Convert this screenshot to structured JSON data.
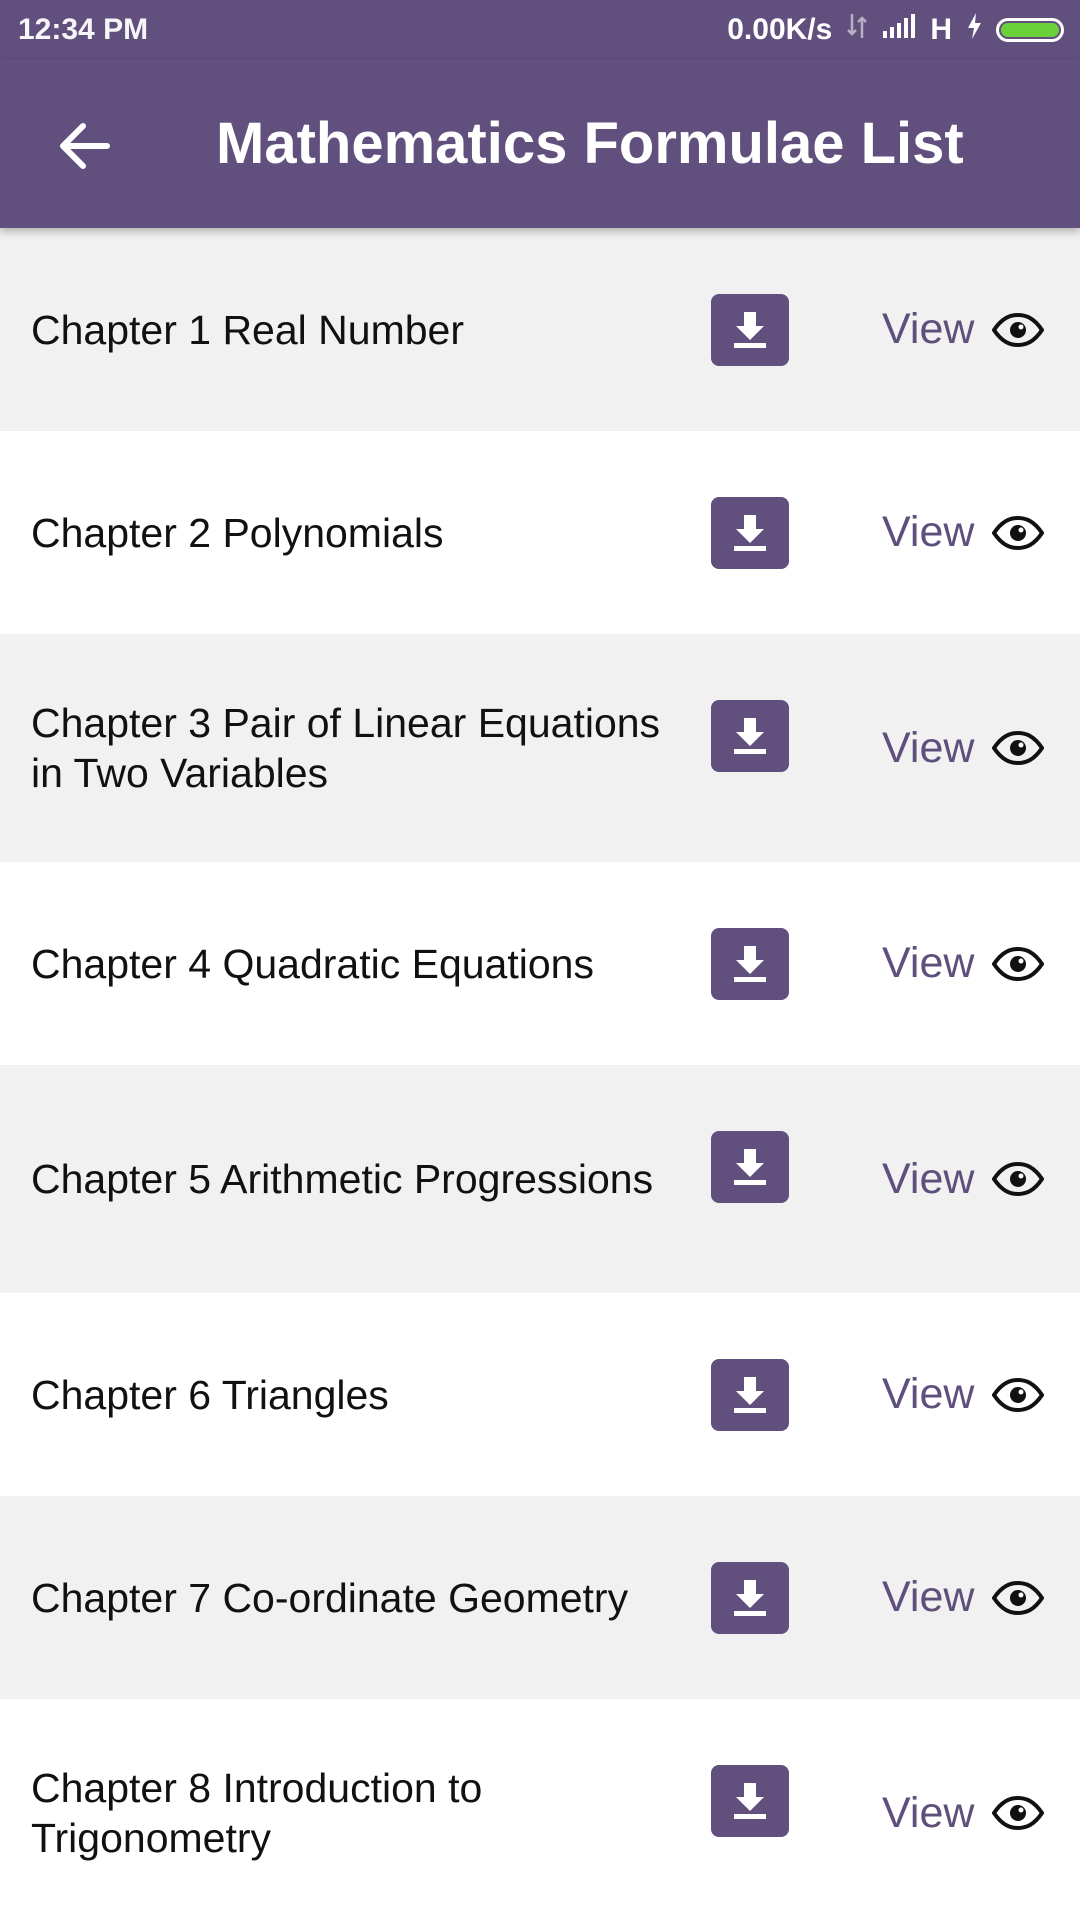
{
  "status_bar": {
    "time": "12:34 PM",
    "net_speed": "0.00K/s",
    "network_type": "H"
  },
  "app_bar": {
    "title": "Mathematics Formulae List",
    "back_icon": "arrow-back-icon"
  },
  "chapters": [
    {
      "title": "Chapter 1 Real Number",
      "view_label": "View"
    },
    {
      "title": "Chapter 2 Polynomials",
      "view_label": "View"
    },
    {
      "title": "Chapter 3 Pair of Linear Equations in Two Variables",
      "view_label": "View"
    },
    {
      "title": "Chapter 4 Quadratic Equations",
      "view_label": "View"
    },
    {
      "title": "Chapter 5 Arithmetic Progressions",
      "view_label": "View"
    },
    {
      "title": "Chapter 6 Triangles",
      "view_label": "View"
    },
    {
      "title": "Chapter 7 Co-ordinate Geometry",
      "view_label": "View"
    },
    {
      "title": "Chapter 8 Introduction to Trigonometry",
      "view_label": "View"
    }
  ],
  "colors": {
    "primary": "#614f7e",
    "row_alt": "#f1f1f1",
    "battery": "#6bd13a"
  }
}
